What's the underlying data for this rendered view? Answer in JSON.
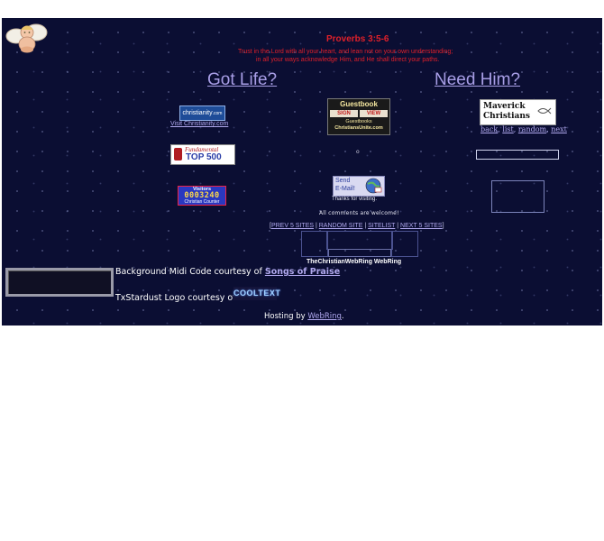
{
  "verse": {
    "reference": "Proverbs 3:5-6",
    "line1": "Trust in the Lord with all your heart, and lean not on your own understanding;",
    "line2": "in all your ways acknowledge Him, and He shall direct your paths."
  },
  "headings": {
    "left": "Got Life?",
    "right": "Need Him?"
  },
  "badges": {
    "christianity_logo": "christianity",
    "christianity_logo_suffix": ".com",
    "christianity_link": "Visit Christianity.com",
    "guestbook_title": "Guestbook",
    "guestbook_sign": "SIGN",
    "guestbook_view": "VIEW",
    "guestbook_sub": "Guestbooks",
    "guestbook_domain": "ChristiansUnite.com",
    "maverick_line1": "Maverick",
    "maverick_line2": "Christians",
    "fundamental_line1": "Fundamental",
    "fundamental_line2": "TOP 500",
    "visitors_title": "Visitors",
    "visitors_count": "0003240",
    "visitors_sub": "Christian Counter",
    "send_line1": "Send",
    "send_line2": "E-Mail!",
    "send_caption": "Thanks for visiting.",
    "small_dot": "o"
  },
  "maverick_nav": [
    "back",
    "list",
    "random",
    "next"
  ],
  "comments": "All comments are welcome!",
  "webring_nav": {
    "open": "[",
    "prev": "PREV 5 SITES",
    "random": "RANDOM SITE",
    "sitelist": "SITELIST",
    "next": "NEXT 5 SITES",
    "close": "]",
    "sep": " | "
  },
  "webring_name": "TheChristianWebRing WebRing",
  "credits": {
    "midi_prefix": "Background Midi Code courtesy of ",
    "midi_link": "Songs of Praise",
    "logo_prefix": "TxStardust Logo courtesy of",
    "cooltext": "COOLTEXT"
  },
  "hosting": {
    "prefix": "Hosting by ",
    "link": "WebRing",
    "suffix": "."
  },
  "colors": {
    "background": "#0b0e33",
    "verse_red": "#e0202a",
    "link": "#b0a8ee",
    "heading": "#a89ee6"
  },
  "icons": {
    "corner": "cherub-angel-icon",
    "fish": "ichthys-fish-icon",
    "globe": "globe-icon"
  }
}
